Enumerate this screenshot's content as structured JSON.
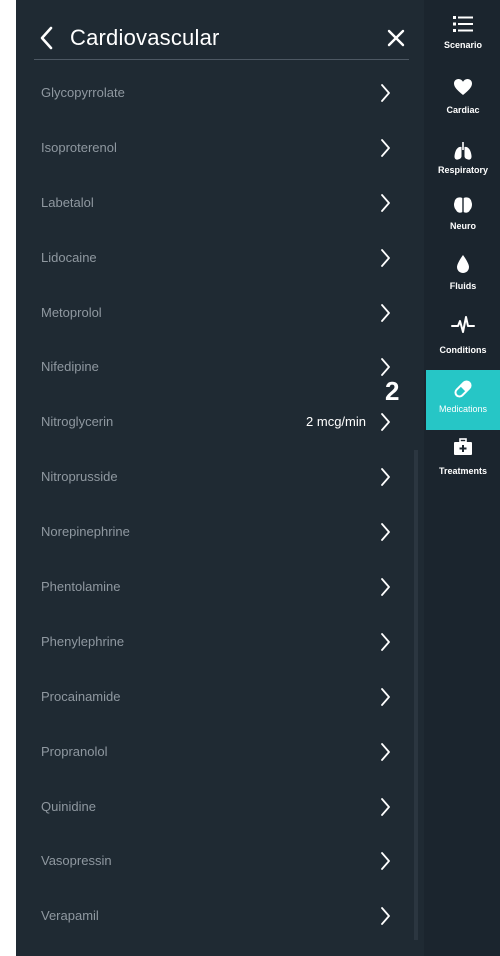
{
  "header": {
    "title": "Cardiovascular"
  },
  "medications": [
    {
      "label": "Glycopyrrolate",
      "value": ""
    },
    {
      "label": "Isoproterenol",
      "value": ""
    },
    {
      "label": "Labetalol",
      "value": ""
    },
    {
      "label": "Lidocaine",
      "value": ""
    },
    {
      "label": "Metoprolol",
      "value": ""
    },
    {
      "label": "Nifedipine",
      "value": ""
    },
    {
      "label": "Nitroglycerin",
      "value": "2 mcg/min"
    },
    {
      "label": "Nitroprusside",
      "value": ""
    },
    {
      "label": "Norepinephrine",
      "value": ""
    },
    {
      "label": "Phentolamine",
      "value": ""
    },
    {
      "label": "Phenylephrine",
      "value": ""
    },
    {
      "label": "Procainamide",
      "value": ""
    },
    {
      "label": "Propranolol",
      "value": ""
    },
    {
      "label": "Quinidine",
      "value": ""
    },
    {
      "label": "Vasopressin",
      "value": ""
    },
    {
      "label": "Verapamil",
      "value": ""
    }
  ],
  "nav": [
    {
      "label": "Scenario",
      "icon": "list-icon"
    },
    {
      "label": "Cardiac",
      "icon": "heart-icon"
    },
    {
      "label": "Respiratory",
      "icon": "lungs-icon"
    },
    {
      "label": "Neuro",
      "icon": "brain-icon"
    },
    {
      "label": "Fluids",
      "icon": "drop-icon"
    },
    {
      "label": "Conditions",
      "icon": "pulse-icon"
    },
    {
      "label": "Medications",
      "icon": "pill-icon",
      "active": true
    },
    {
      "label": "Treatments",
      "icon": "medkit-icon"
    }
  ],
  "annotation": {
    "step": "2"
  },
  "colors": {
    "panel": "#1f2a33",
    "nav": "#1b252e",
    "accent": "#26c6c6",
    "muted_text": "#8f98a0"
  }
}
